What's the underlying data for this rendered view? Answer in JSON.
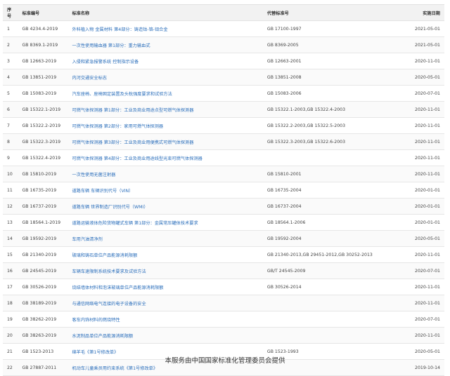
{
  "table": {
    "headers": [
      "序号",
      "标准编号",
      "标准名称",
      "代替标准号",
      "实施日期"
    ],
    "rows": [
      {
        "no": "1",
        "code": "GB 4234.4-2019",
        "name": "外科植入物 金属材料 第4部分：铸造钴-铬-钼合金",
        "replaces": "GB 17100-1997",
        "date": "2021-05-01"
      },
      {
        "no": "2",
        "code": "GB 8369.1-2019",
        "name": "一次性使用输血器 第1部分：重力输血式",
        "replaces": "GB 8369-2005",
        "date": "2021-05-01"
      },
      {
        "no": "3",
        "code": "GB 12663-2019",
        "name": "入侵和紧急报警系统 控制指示设备",
        "replaces": "GB 12663-2001",
        "date": "2020-11-01"
      },
      {
        "no": "4",
        "code": "GB 13851-2019",
        "name": "内河交通安全标志",
        "replaces": "GB 13851-2008",
        "date": "2020-05-01"
      },
      {
        "no": "5",
        "code": "GB 15083-2019",
        "name": "汽车座椅、座椅固定装置及头枕强度要求和试验方法",
        "replaces": "GB 15083-2006",
        "date": "2020-07-01"
      },
      {
        "no": "6",
        "code": "GB 15322.1-2019",
        "name": "可燃气体探测器 第1部分：工业及商业用途点型可燃气体探测器",
        "replaces": "GB 15322.1-2003,GB 15322.4-2003",
        "date": "2020-11-01"
      },
      {
        "no": "7",
        "code": "GB 15322.2-2019",
        "name": "可燃气体探测器 第2部分：家用可燃气体探测器",
        "replaces": "GB 15322.2-2003,GB 15322.5-2003",
        "date": "2020-11-01"
      },
      {
        "no": "8",
        "code": "GB 15322.3-2019",
        "name": "可燃气体探测器 第3部分：工业及商业用便携式可燃气体探测器",
        "replaces": "GB 15322.3-2003,GB 15322.6-2003",
        "date": "2020-11-01"
      },
      {
        "no": "9",
        "code": "GB 15322.4-2019",
        "name": "可燃气体探测器 第4部分：工业及商业用途线型光束可燃气体探测器",
        "replaces": "",
        "date": "2020-11-01"
      },
      {
        "no": "10",
        "code": "GB 15810-2019",
        "name": "一次性使用无菌注射器",
        "replaces": "GB 15810-2001",
        "date": "2020-11-01"
      },
      {
        "no": "11",
        "code": "GB 16735-2019",
        "name": "道路车辆 车辆识别代号（VIN）",
        "replaces": "GB 16735-2004",
        "date": "2020-01-01"
      },
      {
        "no": "12",
        "code": "GB 16737-2019",
        "name": "道路车辆 世界制造厂识别代号（WMI）",
        "replaces": "GB 16737-2004",
        "date": "2020-01-01"
      },
      {
        "no": "13",
        "code": "GB 18564.1-2019",
        "name": "道路运输液体危险货物罐式车辆 第1部分：金属常压罐体技术要求",
        "replaces": "GB 18564.1-2006",
        "date": "2020-01-01"
      },
      {
        "no": "14",
        "code": "GB 19592-2019",
        "name": "车用汽油清净剂",
        "replaces": "GB 19592-2004",
        "date": "2020-05-01"
      },
      {
        "no": "15",
        "code": "GB 21340-2019",
        "name": "玻璃和铸石单位产品能源消耗限额",
        "replaces": "GB 21340-2013,GB 29451-2012,GB 30252-2013",
        "date": "2020-11-01"
      },
      {
        "no": "16",
        "code": "GB 24545-2019",
        "name": "车辆车速限制系统技术要求及试验方法",
        "replaces": "GB/T 24545-2009",
        "date": "2020-07-01"
      },
      {
        "no": "17",
        "code": "GB 30526-2019",
        "name": "烧结墙体材料和泡沫玻璃单位产品能源消耗限额",
        "replaces": "GB 30526-2014",
        "date": "2020-11-01"
      },
      {
        "no": "18",
        "code": "GB 38189-2019",
        "name": "与通信网络电气连接的电子设备的安全",
        "replaces": "",
        "date": "2020-11-01"
      },
      {
        "no": "19",
        "code": "GB 38262-2019",
        "name": "客车内饰材料的燃烧特性",
        "replaces": "",
        "date": "2020-07-01"
      },
      {
        "no": "20",
        "code": "GB 38263-2019",
        "name": "水泥制品单位产品能源消耗限额",
        "replaces": "",
        "date": "2020-11-01"
      },
      {
        "no": "21",
        "code": "GB 1523-2013",
        "name": "绵羊毛《第1号修改单》",
        "replaces": "GB 1523-1993",
        "date": "2020-05-01"
      },
      {
        "no": "22",
        "code": "GB 27887-2011",
        "name": "机动车儿童乘员用约束系统《第1号修改单》",
        "replaces": "",
        "date": "2019-10-14"
      }
    ]
  },
  "footer": "本服务由中国国家标准化管理委员会提供"
}
